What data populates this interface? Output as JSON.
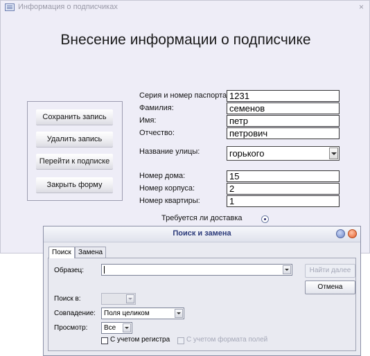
{
  "window": {
    "title": "Информация о подписчиках",
    "close_glyph": "×"
  },
  "form": {
    "heading": "Внесение информации о подписчике",
    "buttons": {
      "save": "Сохранить запись",
      "delete": "Удалить запись",
      "goto_subscription": "Перейти к подписке",
      "close_form": "Закрыть форму"
    },
    "fields": {
      "passport_label": "Серия и номер паспорта:",
      "passport_value": "1231",
      "surname_label": "Фамилия:",
      "surname_value": "семенов",
      "name_label": "Имя:",
      "name_value": "петр",
      "patronymic_label": "Отчество:",
      "patronymic_value": "петрович",
      "street_label": "Название улицы:",
      "street_value": "горького",
      "house_label": "Номер дома:",
      "house_value": "15",
      "building_label": "Номер корпуса:",
      "building_value": "2",
      "apartment_label": "Номер квартиры:",
      "apartment_value": "1",
      "delivery_label": "Требуется ли доставка"
    }
  },
  "dialog": {
    "title": "Поиск и замена",
    "tabs": [
      "Поиск",
      "Замена"
    ],
    "find_label": "Образец:",
    "find_value": "",
    "find_next": "Найти далее",
    "cancel": "Отмена",
    "look_in_label": "Поиск в:",
    "look_in_value": "",
    "match_label": "Совпадение:",
    "match_value": "Поля целиком",
    "search_label": "Просмотр:",
    "search_value": "Все",
    "match_case": "С учетом регистра",
    "search_formatted": "С учетом формата полей"
  },
  "colors": {
    "form_bg": "#eeedf7",
    "dialog_title": "#2b3a7a",
    "disabled_text": "#a5a8b8"
  }
}
